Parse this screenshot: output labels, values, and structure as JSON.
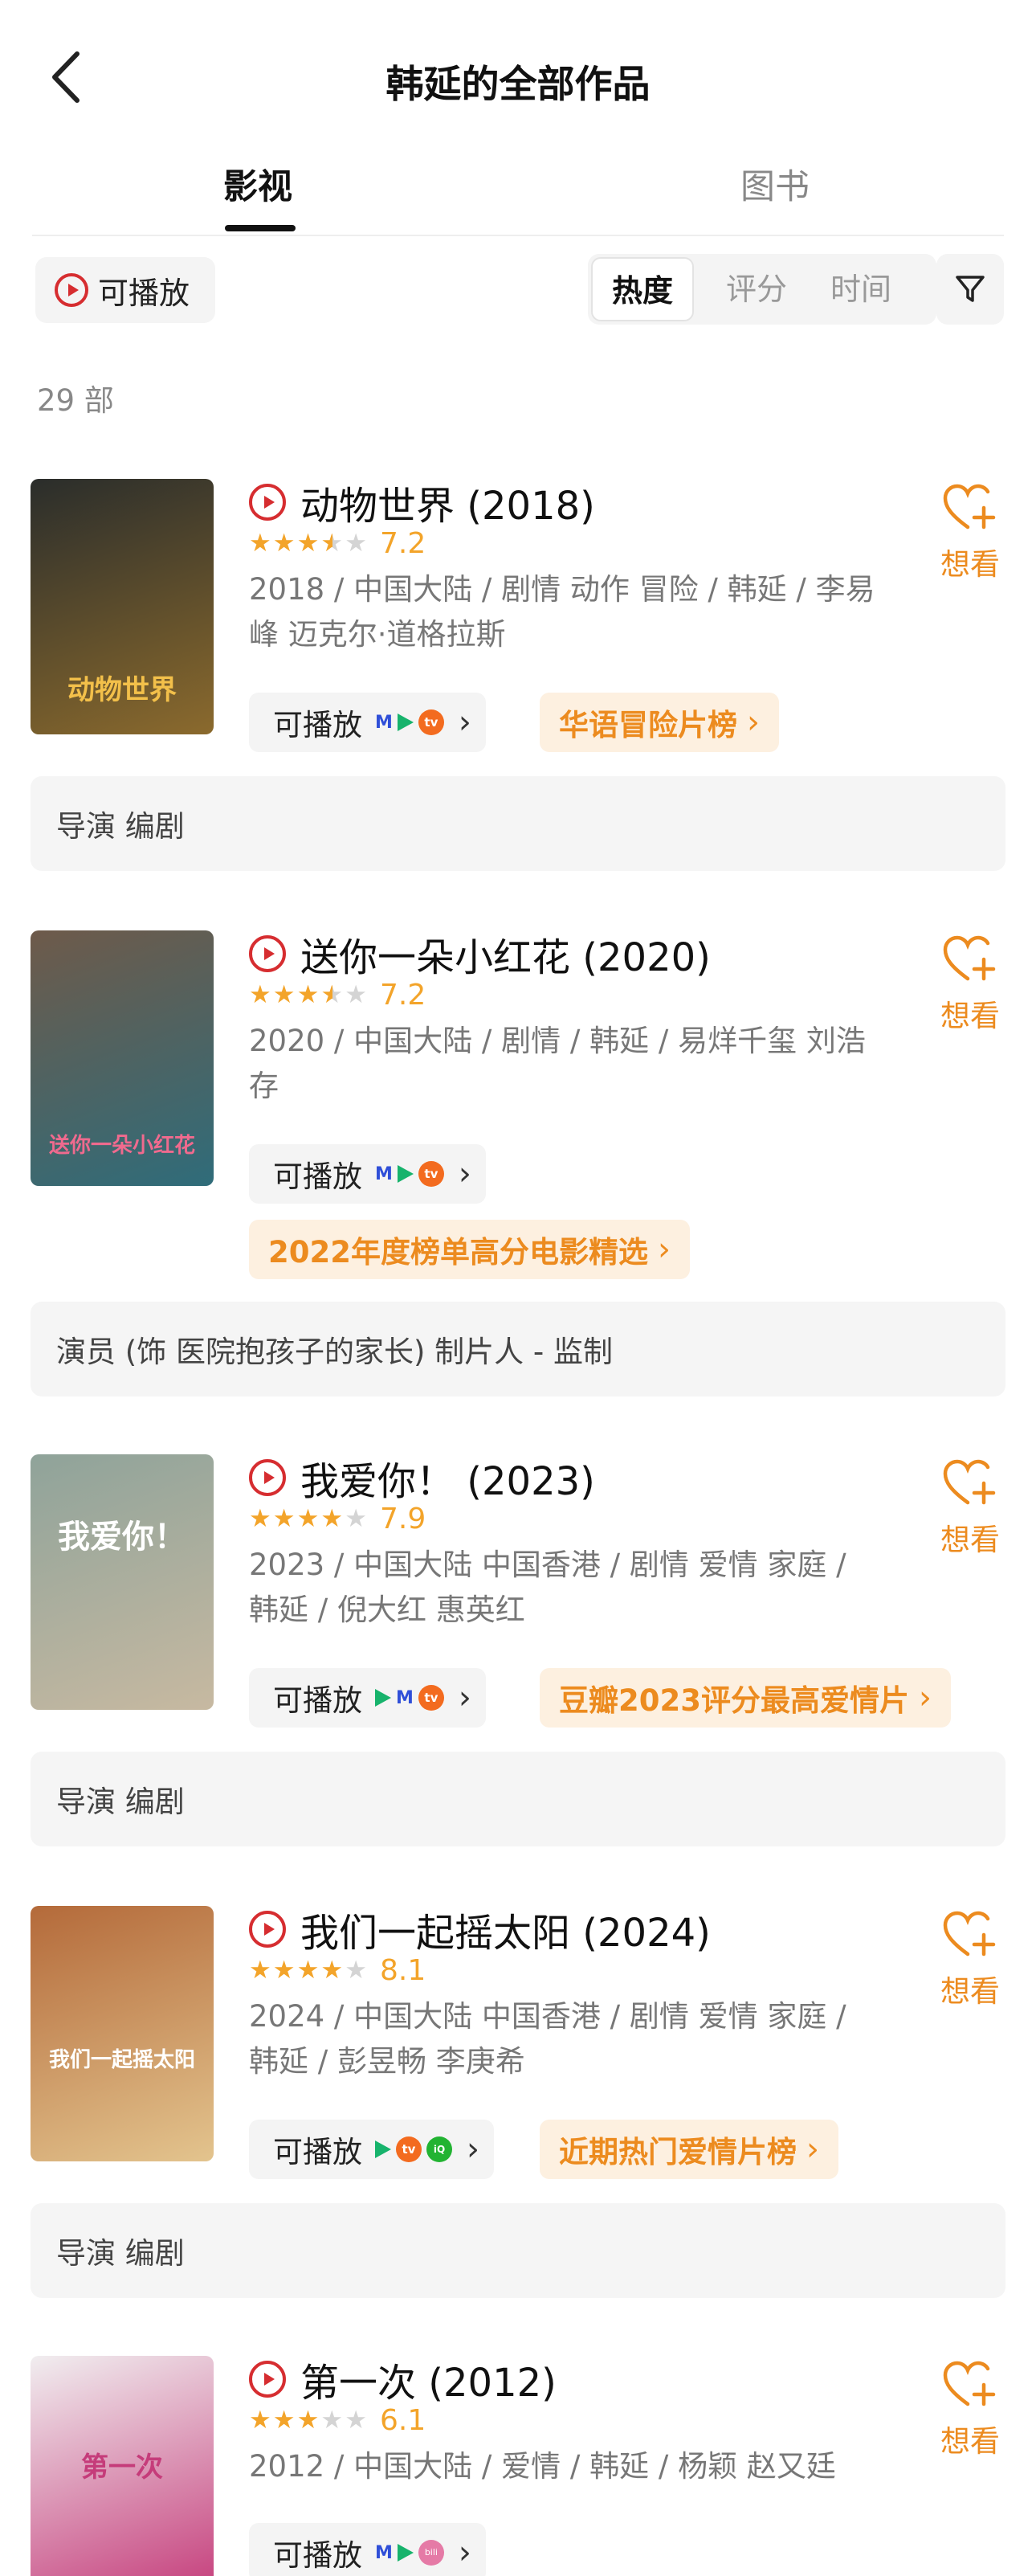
{
  "header": {
    "title": "韩延的全部作品"
  },
  "tabs": [
    {
      "label": "影视"
    },
    {
      "label": "图书"
    }
  ],
  "filters": {
    "playable_label": "可播放",
    "sort_options": [
      "热度",
      "评分",
      "时间"
    ],
    "active_sort": "热度"
  },
  "count_text": "29 部",
  "items": [
    {
      "title": "动物世界 (2018)",
      "stars": 3.5,
      "rating": "7.2",
      "meta": "2018 / 中国大陆 / 剧情 动作 冒险 / 韩延 / 李易峰 迈克尔·道格拉斯",
      "play_label": "可播放",
      "platforms": [
        "mgtv-icon",
        "tencent-video-icon",
        "youku-icon"
      ],
      "rank_label": "华语冒险片榜",
      "want_label": "想看",
      "role": "导演 编剧",
      "poster_text": "动物世界",
      "poster_colors": [
        "#2a2d2b",
        "#8b6a2d"
      ]
    },
    {
      "title": "送你一朵小红花 (2020)",
      "stars": 3.5,
      "rating": "7.2",
      "meta": "2020 / 中国大陆 / 剧情 / 韩延 / 易烊千玺 刘浩存",
      "play_label": "可播放",
      "platforms": [
        "mgtv-icon",
        "tencent-video-icon",
        "youku-icon"
      ],
      "rank_label": "2022年度榜单高分电影精选",
      "want_label": "想看",
      "role": "演员 (饰 医院抱孩子的家长) 制片人 - 监制",
      "poster_text": "送你一朵小红花",
      "poster_colors": [
        "#6e5a4a",
        "#2f6c7a"
      ]
    },
    {
      "title": "我爱你！ (2023)",
      "stars": 4,
      "rating": "7.9",
      "meta": "2023 / 中国大陆 中国香港 / 剧情 爱情 家庭 / 韩延 / 倪大红 惠英红",
      "play_label": "可播放",
      "platforms": [
        "tencent-video-icon",
        "mgtv-icon",
        "youku-icon"
      ],
      "rank_label": "豆瓣2023评分最高爱情片",
      "want_label": "想看",
      "role": "导演 编剧",
      "poster_text": "我爱你！",
      "poster_colors": [
        "#8fa39a",
        "#c7b9a1"
      ]
    },
    {
      "title": "我们一起摇太阳 (2024)",
      "stars": 4,
      "rating": "8.1",
      "meta": "2024 / 中国大陆 中国香港 / 剧情 爱情 家庭 / 韩延 / 彭昱畅 李庚希",
      "play_label": "可播放",
      "platforms": [
        "tencent-video-icon",
        "youku-icon",
        "iqiyi-icon"
      ],
      "rank_label": "近期热门爱情片榜",
      "want_label": "想看",
      "role": "导演 编剧",
      "poster_text": "我们一起摇太阳",
      "poster_colors": [
        "#b46a3a",
        "#e3c48e"
      ]
    },
    {
      "title": "第一次 (2012)",
      "stars": 3,
      "rating": "6.1",
      "meta": "2012 / 中国大陆 / 爱情 / 韩延 / 杨颖 赵又廷",
      "play_label": "可播放",
      "platforms": [
        "mgtv-icon",
        "tencent-video-icon",
        "bilibili-icon"
      ],
      "rank_label": "",
      "want_label": "想看",
      "role": "",
      "poster_text": "第一次",
      "poster_colors": [
        "#f1eef0",
        "#c53c7a"
      ]
    }
  ]
}
